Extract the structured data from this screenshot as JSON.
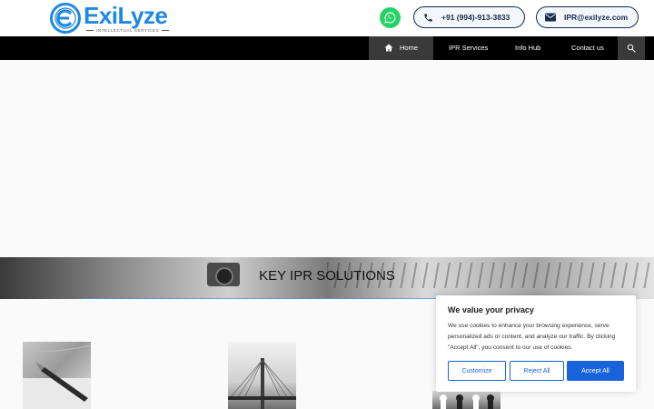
{
  "brand": {
    "name": "ExiLyze",
    "tagline": "INTELLECTUAL SERVICES",
    "color": "#1e88e5"
  },
  "contact": {
    "phone": "+91 (994)-913-3833",
    "email": "IPR@exilyze.com",
    "whatsapp_icon": "whatsapp-icon"
  },
  "nav": {
    "items": [
      {
        "label": "Home",
        "icon": "home-icon",
        "active": true
      },
      {
        "label": "IPR Services"
      },
      {
        "label": "Info Hub"
      },
      {
        "label": "Contact us"
      }
    ],
    "search_icon": "search-icon"
  },
  "banner": {
    "title": "KEY IPR SOLUTIONS"
  },
  "cookie": {
    "title": "We value your privacy",
    "text": "We use cookies to enhance your browsing experience, serve personalized ads or content, and analyze our traffic. By clicking \"Accept All\", you consent to our use of cookies.",
    "customize_label": "Customize",
    "reject_label": "Reject All",
    "accept_label": "Accept All",
    "accent": "#1863dc"
  }
}
